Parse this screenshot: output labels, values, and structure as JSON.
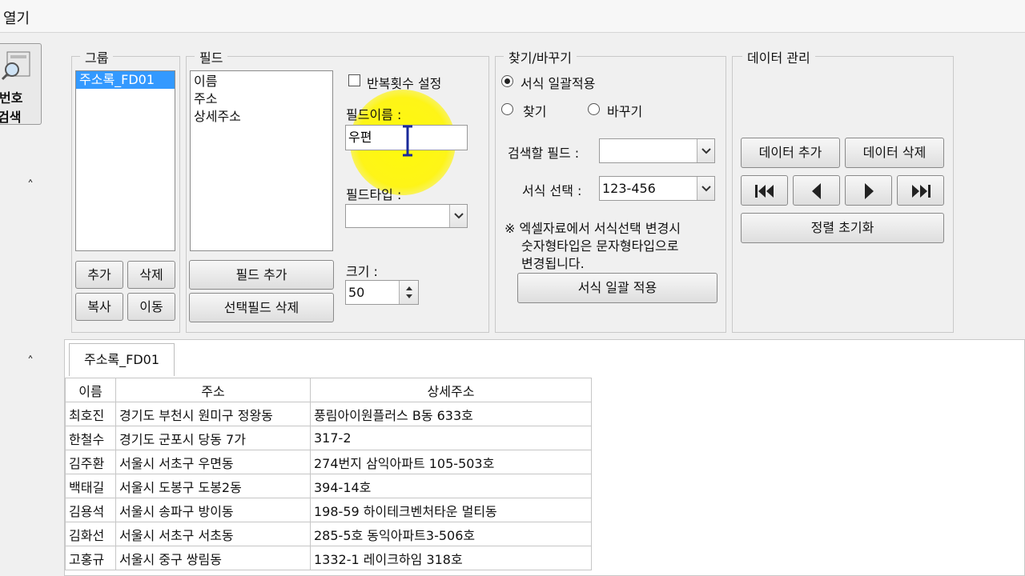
{
  "window": {
    "title": "열기"
  },
  "left_button": {
    "line1": "번호",
    "line2": "검색"
  },
  "group": {
    "legend": "그룹",
    "items": [
      "주소록_FD01"
    ],
    "add": "추가",
    "delete": "삭제",
    "copy": "복사",
    "move": "이동"
  },
  "field": {
    "legend": "필드",
    "items": [
      "이름",
      "주소",
      "상세주소"
    ],
    "repeat_label": "반복횟수 설정",
    "name_label": "필드이름 :",
    "name_value": "우편",
    "type_label": "필드타입 :",
    "type_value": "",
    "size_label": "크기 :",
    "size_value": "50",
    "add_button": "필드 추가",
    "delete_button": "선택필드 삭제"
  },
  "find": {
    "legend": "찾기/바꾸기",
    "opt_format": "서식 일괄적용",
    "opt_find": "찾기",
    "opt_replace": "바꾸기",
    "search_field_label": "검색할 필드 :",
    "search_field_value": "",
    "format_label": "서식 선택 :",
    "format_value": "123-456",
    "note1": "※ 엑셀자료에서 서식선택 변경시",
    "note2": "숫자형타입은 문자형타입으로",
    "note3": "변경됩니다.",
    "apply_button": "서식 일괄 적용"
  },
  "data": {
    "legend": "데이터 관리",
    "add": "데이터 추가",
    "delete": "데이터 삭제",
    "reset_sort": "정렬 초기화"
  },
  "tab": {
    "label": "주소록_FD01"
  },
  "table": {
    "headers": [
      "이름",
      "주소",
      "상세주소"
    ],
    "rows": [
      [
        "최호진",
        "경기도 부천시 원미구 정왕동",
        "풍림아이원플러스 B동 633호"
      ],
      [
        "한철수",
        "경기도 군포시 당동 7가",
        "317-2"
      ],
      [
        "김주환",
        "서울시 서초구 우면동",
        "274번지 삼익아파트 105-503호"
      ],
      [
        "백태길",
        "서울시 도봉구 도봉2동",
        "394-14호"
      ],
      [
        "김용석",
        "서울시 송파구 방이동",
        "198-59 하이테크벤처타운 멀티동"
      ],
      [
        "김화선",
        "서울시 서초구 서초동",
        "285-5호 동익아파트3-506호"
      ],
      [
        "고홍규",
        "서울시 중구 쌍림동",
        "1332-1 레이크하임 318호"
      ]
    ]
  }
}
